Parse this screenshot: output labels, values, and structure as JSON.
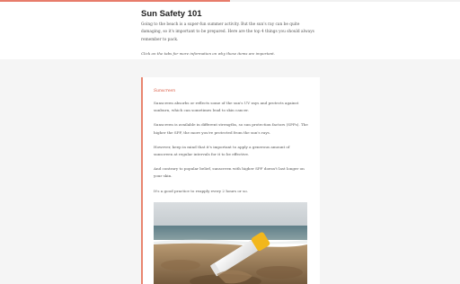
{
  "reading_progress": 0.5,
  "header": {
    "title": "Sun Safety 101",
    "intro": "Going to the beach is a super-fun summer activity. But the sun's ray can be quite damaging, so it's important to be prepared. Here are the top 4 things you should always remember to pack.",
    "hint": "Click on the tabs for more information on why these items are important."
  },
  "card": {
    "heading": "Sunscreen",
    "paragraphs": [
      "Sunscreen absorbs or reflects some of the sun's UV rays and protects against sunburn, which can sometimes lead to skin cancer.",
      "Sunscreen is available in different strengths, so sun protection factors (SPFs). The higher the SPF, the more you're protected from the sun's rays.",
      "However, keep in mind that it's important to apply a generous amount of sunscreen at regular intervals for it to be effective.",
      "And contrary to popular belief, sunscreen with higher SPF doesn't last longer on your skin.",
      "It's a good practice to reapply every 2 hours or so."
    ]
  },
  "colors": {
    "accent": "#e9856f",
    "heading_accent": "#d9533b",
    "background": "#f5f5f5"
  }
}
